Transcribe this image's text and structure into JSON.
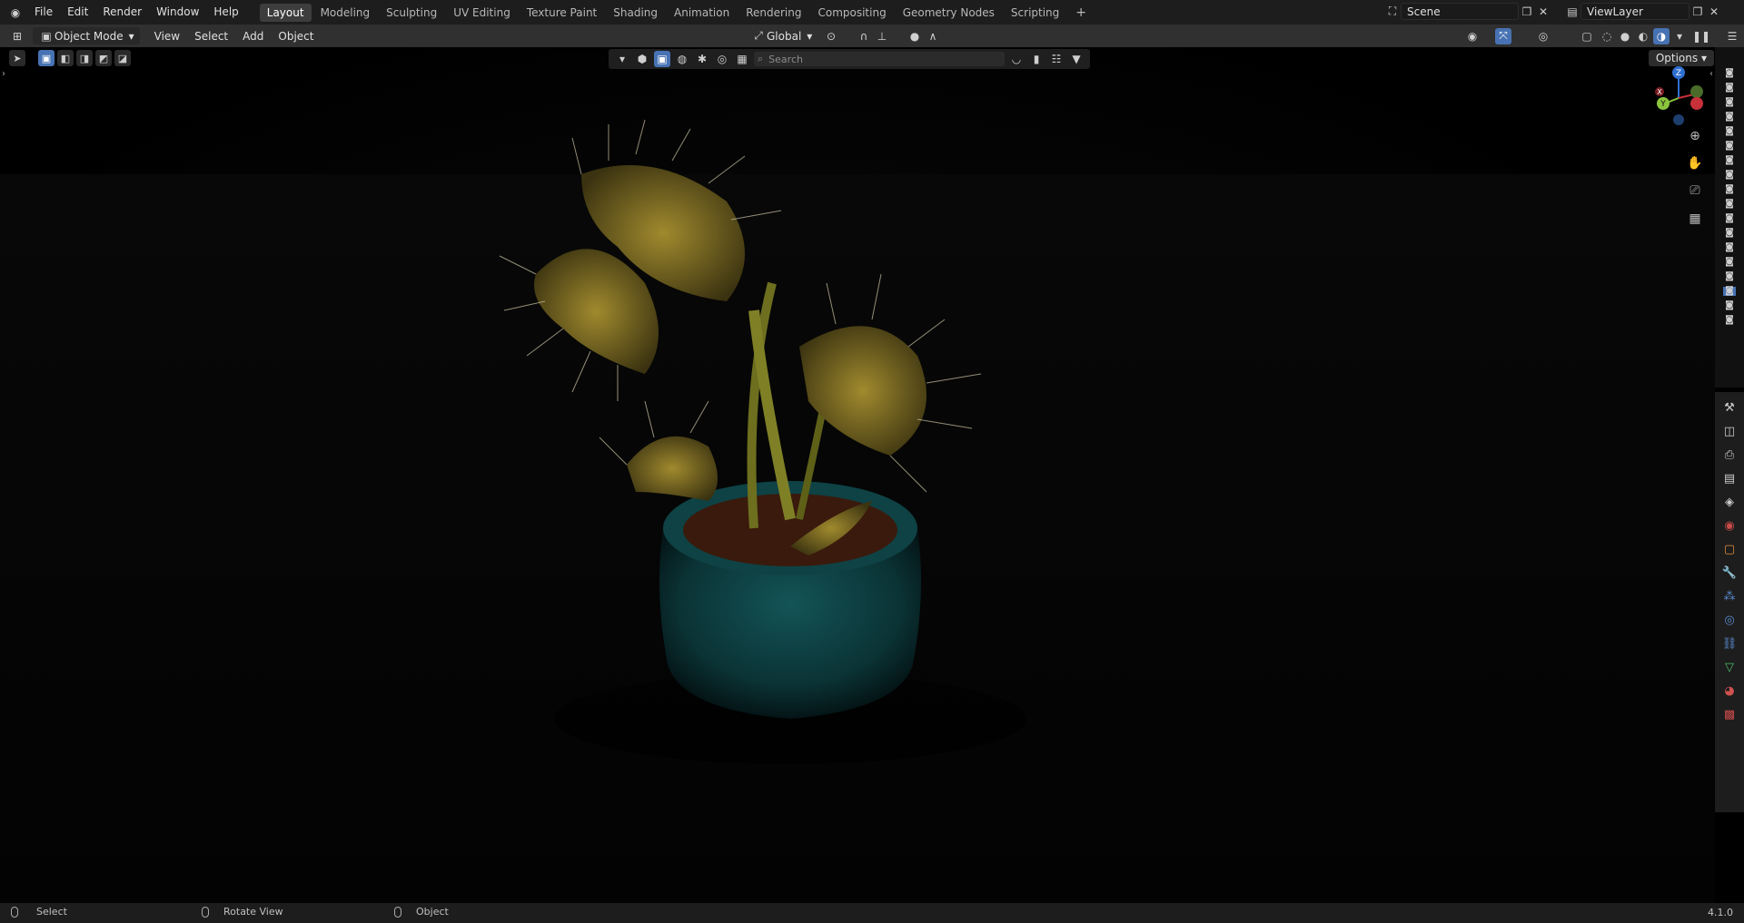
{
  "menu": {
    "file": "File",
    "edit": "Edit",
    "render": "Render",
    "window": "Window",
    "help": "Help"
  },
  "workspaces": [
    "Layout",
    "Modeling",
    "Sculpting",
    "UV Editing",
    "Texture Paint",
    "Shading",
    "Animation",
    "Rendering",
    "Compositing",
    "Geometry Nodes",
    "Scripting"
  ],
  "active_workspace": "Layout",
  "scene": {
    "name": "Scene"
  },
  "view_layer": {
    "name": "ViewLayer"
  },
  "header": {
    "mode": "Object Mode",
    "view": "View",
    "select": "Select",
    "add": "Add",
    "object": "Object",
    "orientation": "Global"
  },
  "viewport": {
    "search_placeholder": "Search",
    "options": "Options",
    "gizmo": {
      "x": "X",
      "y": "Y",
      "z": "Z"
    }
  },
  "status": {
    "left": "Select",
    "middle": "Rotate View",
    "right": "Object",
    "version": "4.1.0"
  },
  "colors": {
    "accent": "#4772b3",
    "axis_x": "#c8303a",
    "axis_y": "#8ac53d",
    "axis_z": "#2f6fd1",
    "pot": "#0d3d3f",
    "plant": "#8a7a2a"
  }
}
